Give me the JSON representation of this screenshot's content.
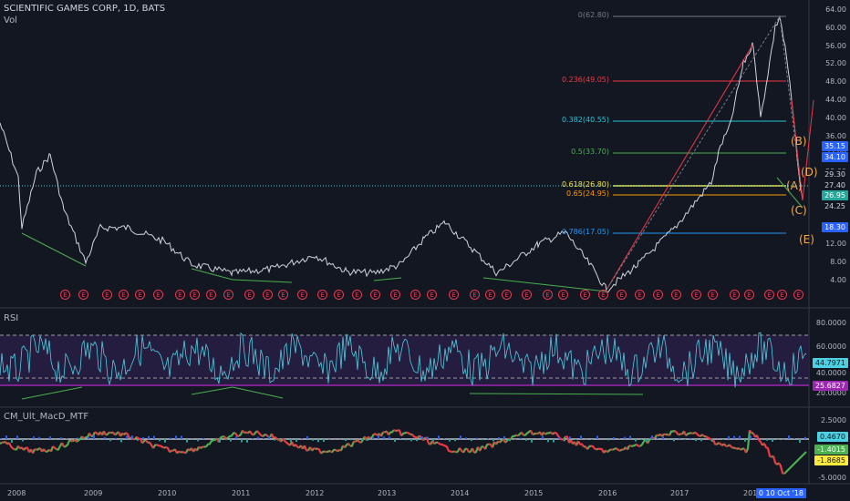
{
  "header": {
    "title": "SCIENTIFIC GAMES CORP, 1D, BATS",
    "vol_label": "Vol"
  },
  "rsi_pane": {
    "label": "RSI"
  },
  "macd_pane": {
    "label": "CM_Ult_MacD_MTF"
  },
  "price_axis": [
    "64.00",
    "60.00",
    "56.00",
    "52.00",
    "48.00",
    "44.00",
    "40.00",
    "36.00",
    "32.00",
    "28.00",
    "24.00",
    "20.00",
    "16.00",
    "12.00",
    "8.00",
    "4.00"
  ],
  "rsi_axis": [
    "80.0000",
    "60.0000",
    "40.0000",
    "20.0000"
  ],
  "macd_axis": [
    "2.5000",
    "-5.0000"
  ],
  "tags": {
    "p1": "35.15",
    "p2": "34.10",
    "p3": "29.30",
    "p4": "27.40",
    "p5": "26.95",
    "p6": "24.25",
    "p7": "18.30",
    "rsi1": "44.7971",
    "rsi2": "25.6827",
    "m1": "0.4670",
    "m2": "-1.4015",
    "m3": "-1.8685"
  },
  "fib_levels": [
    {
      "label": "0(62.80)",
      "color": "#787b86"
    },
    {
      "label": "0.236(49.05)",
      "color": "#f23645"
    },
    {
      "label": "0.382(40.55)",
      "color": "#22c7d8"
    },
    {
      "label": "0.5(33.70)",
      "color": "#4caf50"
    },
    {
      "label": "0.618(26.80)",
      "color": "#f5e642"
    },
    {
      "label": "0.65(24.95)",
      "color": "#ff9800"
    },
    {
      "label": "0.786(17.05)",
      "color": "#2196f3"
    }
  ],
  "waves": [
    "(B)",
    "(D)",
    "(A)",
    "(C)",
    "(E)"
  ],
  "x_axis": [
    "2008",
    "2009",
    "2010",
    "2011",
    "2012",
    "2013",
    "2014",
    "2015",
    "2016",
    "2017",
    "2018"
  ],
  "date_tag": "0  10 Oct '18",
  "earnings_badge": "E",
  "colors": {
    "bg": "#131722",
    "price": "#d1d4dc",
    "rsi": "#4dd0e1",
    "macd_up": "#4caf50",
    "macd_dn": "#f23645"
  }
}
